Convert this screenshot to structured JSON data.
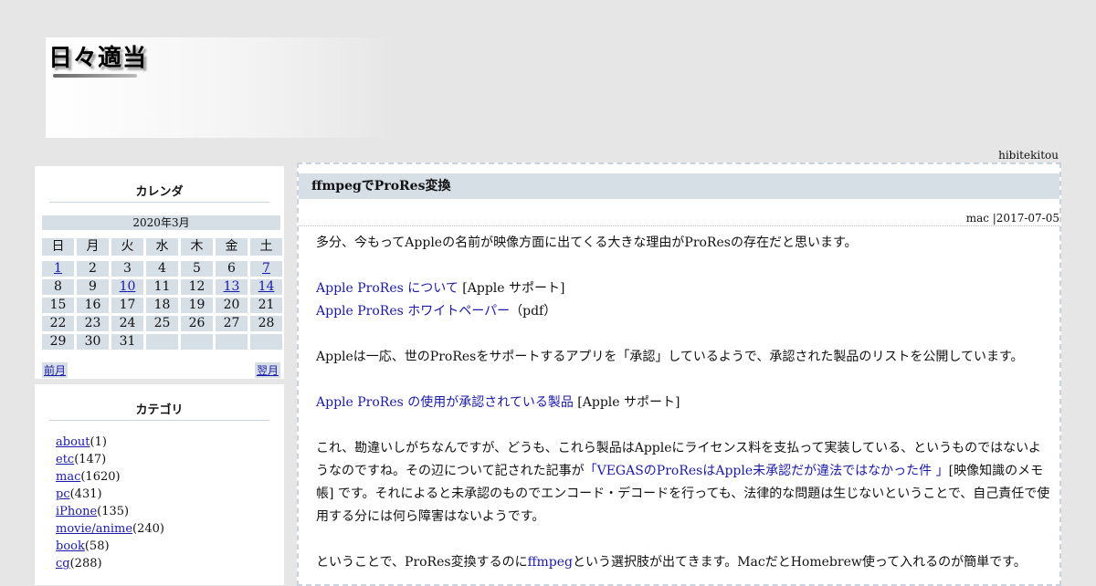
{
  "site": {
    "title": "日々適当",
    "author": "hibitekitou"
  },
  "calendar": {
    "title": "カレンダ",
    "month": "2020年3月",
    "weekdays": [
      "日",
      "月",
      "火",
      "水",
      "木",
      "金",
      "土"
    ],
    "weeks": [
      [
        "1",
        "2",
        "3",
        "4",
        "5",
        "6",
        "7"
      ],
      [
        "8",
        "9",
        "10",
        "11",
        "12",
        "13",
        "14"
      ],
      [
        "15",
        "16",
        "17",
        "18",
        "19",
        "20",
        "21"
      ],
      [
        "22",
        "23",
        "24",
        "25",
        "26",
        "27",
        "28"
      ],
      [
        "29",
        "30",
        "31",
        "",
        "",
        "",
        ""
      ]
    ],
    "linked_days": [
      "1",
      "7",
      "10",
      "13",
      "14"
    ],
    "prev": "前月",
    "next": "翌月"
  },
  "categories": {
    "title": "カテゴリ",
    "items": [
      {
        "name": "about",
        "count": "(1)"
      },
      {
        "name": "etc",
        "count": "(147)"
      },
      {
        "name": "mac",
        "count": "(1620)"
      },
      {
        "name": "pc",
        "count": "(431)"
      },
      {
        "name": "iPhone",
        "count": "(135)"
      },
      {
        "name": "movie/anime",
        "count": "(240)"
      },
      {
        "name": "book",
        "count": "(58)"
      },
      {
        "name": "cg",
        "count": "(288)"
      }
    ]
  },
  "post": {
    "title": "ffmpegでProRes変換",
    "meta": "mac |2017-07-05",
    "intro": "多分、今もってAppleの名前が映像方面に出てくる大きな理由がProResの存在だと思います。",
    "link1": "Apple ProRes について",
    "link1_suffix": " [Apple サポート]",
    "link2": "Apple ProRes ホワイトペーパー",
    "link2_suffix": "（pdf）",
    "para2": "Appleは一応、世のProResをサポートするアプリを「承認」しているようで、承認された製品のリストを公開しています。",
    "link3": "Apple ProRes の使用が承認されている製品",
    "link3_suffix": " [Apple サポート]",
    "para3_a": "これ、勘違いしがちなんですが、どうも、これら製品はAppleにライセンス料を支払って実装している、というものではないようなのですね。その辺について記された記事が",
    "para3_link": "「VEGASのProResはApple未承認だが違法ではなかった件 」",
    "para3_b": "[映像知識のメモ帳] です。それによると未承認のものでエンコード・デコードを行っても、法律的な問題は生じないということで、自己責任で使用する分には何ら障害はないようです。",
    "para4_a": "ということで、ProRes変換するのに",
    "para4_link": "ffmpeg",
    "para4_b": "という選択肢が出てきます。MacだとHomebrew使って入れるのが簡単です。"
  }
}
